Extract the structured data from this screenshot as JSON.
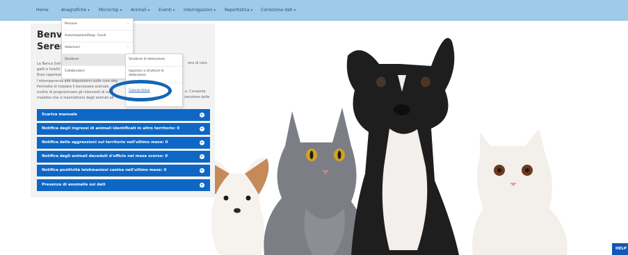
{
  "nav": {
    "items": [
      {
        "label": "Home",
        "caret": ""
      },
      {
        "label": "Anagrafiche",
        "caret": "▾"
      },
      {
        "label": "Microchip",
        "caret": "▾"
      },
      {
        "label": "Animali",
        "caret": "▾"
      },
      {
        "label": "Eventi",
        "caret": "▾"
      },
      {
        "label": "Interrogazioni",
        "caret": "▾"
      },
      {
        "label": "Reportistica",
        "caret": "▾"
      },
      {
        "label": "Correzione dati",
        "caret": "▾"
      }
    ]
  },
  "welcome": {
    "line1": "Benve",
    "line2": "Serena"
  },
  "intro": {
    "lines": [
      "La Banca Dati",
      "gatti e furetti",
      "Esso rappresen",
      "l'ottemperanza alle disposizioni sulla cura deg",
      "Permette di tutelare il benessere animale",
      "inoltre di programmare gli interventi di su",
      "malattie che si trasmettono dagli animali all"
    ],
    "right_fragments": [
      "ono di cani,",
      "o. Consente",
      "venzione delle"
    ]
  },
  "buttons": [
    {
      "label": "Scarica manuale"
    },
    {
      "label": "Notifica degli ingressi di animali identificati in altro territorio: 0"
    },
    {
      "label": "Notifica delle aggressioni sul territorio nell'ultimo mese: 0"
    },
    {
      "label": "Notifica degli animali deceduti d'ufficio nel mese scorso: 0"
    },
    {
      "label": "Notifica positività leishmaniosi canina nell'ultimo mese: 0"
    },
    {
      "label": "Presenza di anomalie sui dati"
    }
  ],
  "anagrafiche_menu": [
    {
      "label": "Persone",
      "arrow": "›"
    },
    {
      "label": "Autorizzazioni/Resp. Canili",
      "arrow": ""
    },
    {
      "label": "Veterinari",
      "arrow": "›"
    },
    {
      "label": "Strutture",
      "arrow": "›"
    },
    {
      "label": "Collaboratori",
      "arrow": ""
    }
  ],
  "strutture_submenu": [
    {
      "label": "Strutture di detenzione"
    },
    {
      "label": "Ispezioni a strutture di detenzione"
    },
    {
      "label": "Colonie feline"
    }
  ],
  "help": {
    "label": "HELP"
  },
  "colors": {
    "nav_bg": "#9fcae8",
    "button_blue": "#0e67c5",
    "highlight_ring": "#1466b6"
  }
}
